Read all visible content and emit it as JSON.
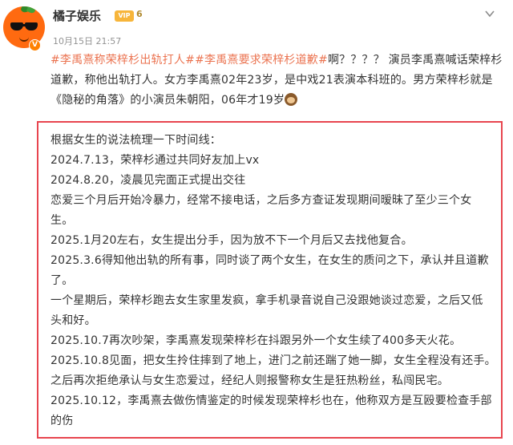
{
  "post": {
    "username": "橘子娱乐",
    "vip_label": "VIP",
    "vip_level": "6",
    "timestamp": "10月15日 21:57",
    "hashtag1": "#李禹熹称荣梓杉出轨打人#",
    "hashtag2": "#李禹熹要求荣梓杉道歉#",
    "line1_rest": "啊？？？？ 演员李禹熹喊话荣梓杉",
    "line2": "道歉，称他出轨打人。女方李禹熹02年23岁，是中戏21表演本科班的。男方荣梓杉就是",
    "line3": "《隐秘的角落》的小演员朱朝阳，06年才19岁",
    "emoji_icon": "monkey-see-no-evil-emoji"
  },
  "highlight_box": {
    "lines": [
      "根据女生的说法梳理一下时间线：",
      "2024.7.13，荣梓杉通过共同好友加上vx",
      "2024.8.20，凌晨见完面正式提出交往",
      "恋爱三个月后开始冷暴力，经常不接电话，之后多方查证发现期间暧昧了至少三个女",
      "生。",
      "2025.1月20左右，女生提出分手，因为放不下一个月后又去找他复合。",
      "2025.3.6得知他出轨的所有事，同时谈了两个女生，在女生的质问之下，承认并且道歉",
      "了。",
      "一个星期后，荣梓杉跑去女生家里发疯，拿手机录音说自己没跟她谈过恋爱，之后又低",
      "头和好。",
      "2025.10.7再次吵架，李禹熹发现荣梓杉在抖跟另外一个女生续了400多天火花。",
      "2025.10.8见面，把女生拎住摔到了地上，进门之前还踹了她一脚，女生全程没有还手。",
      "之后再次拒绝承认与女生恋爱过，经纪人则报警称女生是狂热粉丝，私闯民宅。",
      "2025.10.12，李禹熹去做伤情鉴定的时候发现荣梓杉也在，他称双方是互殴要检查手部",
      "的伤"
    ],
    "border_color": "#e8454f"
  },
  "colors": {
    "hashtag": "#eb7350",
    "text": "#333333",
    "timestamp": "#939393",
    "verified_badge": "#ff8200"
  }
}
